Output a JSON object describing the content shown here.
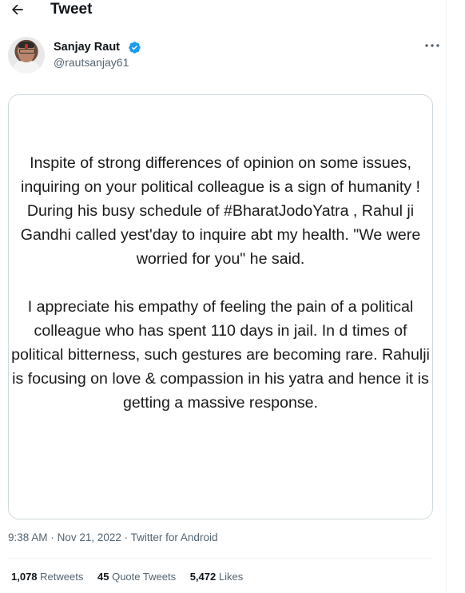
{
  "header": {
    "title": "Tweet"
  },
  "author": {
    "name": "Sanjay Raut",
    "handle": "@rautsanjay61"
  },
  "tweet_image": {
    "paragraph1": "Inspite of strong differences of opinion on some issues, inquiring on your political colleague is a sign of humanity ! During his busy schedule of #BharatJodoYatra , Rahul ji Gandhi called yest'day to inquire abt my health. \"We were worried for you\" he said.",
    "paragraph2": "I appreciate his empathy of feeling the pain of a political colleague who has spent 110 days in jail. In d times of political bitterness, such gestures are becoming rare. Rahulji is focusing on love & compassion in his yatra and hence it is getting a massive response."
  },
  "meta": {
    "time": "9:38 AM",
    "date": "Nov 21, 2022",
    "source": "Twitter for Android",
    "separator": "·"
  },
  "stats": {
    "retweets_count": "1,078",
    "retweets_label": "Retweets",
    "quotes_count": "45",
    "quotes_label": "Quote Tweets",
    "likes_count": "5,472",
    "likes_label": "Likes"
  },
  "icons": {
    "back": "arrow-left-icon",
    "verified": "verified-badge-icon",
    "more": "more-icon"
  },
  "colors": {
    "accent": "#1d9bf0",
    "muted": "#536471",
    "text": "#0f1419",
    "border": "#cfd9de"
  }
}
